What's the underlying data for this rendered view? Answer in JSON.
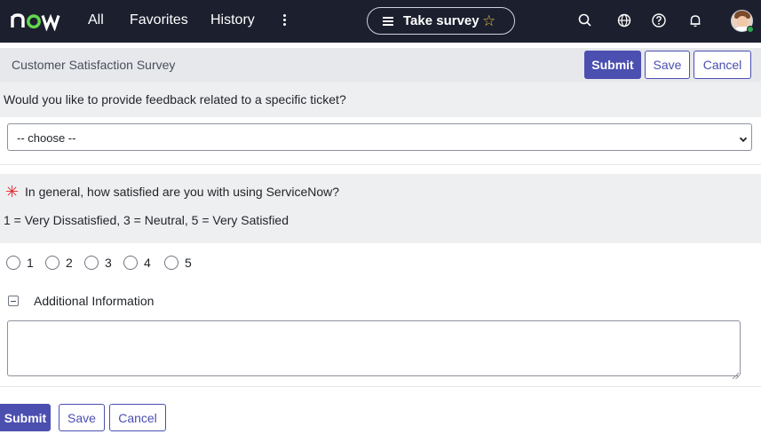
{
  "nav": {
    "logo_text": "now",
    "links": [
      "All",
      "Favorites",
      "History"
    ],
    "pill_label": "Take survey",
    "icons": [
      "search-icon",
      "globe-icon",
      "help-icon",
      "bell-icon"
    ],
    "accent": "#62d84e"
  },
  "survey": {
    "title": "Customer Satisfaction Survey",
    "submit_label": "Submit",
    "save_label": "Save",
    "cancel_label": "Cancel"
  },
  "q1": {
    "text": "Would you like to provide feedback related to a specific ticket?",
    "select_value": "-- choose --"
  },
  "q2": {
    "required_mark": "✳",
    "text": "In general, how satisfied are you with using ServiceNow?",
    "scale": "1 = Very Dissatisfied, 3 = Neutral, 5 = Very Satisfied",
    "options": [
      "1",
      "2",
      "3",
      "4",
      "5"
    ]
  },
  "additional": {
    "label": "Additional Information",
    "value": ""
  },
  "footer": {
    "submit_label": "Submit",
    "save_label": "Save",
    "cancel_label": "Cancel"
  },
  "colors": {
    "nav_bg": "#1b1f2e",
    "primary": "#4b4fb0",
    "required": "#e0272b"
  }
}
